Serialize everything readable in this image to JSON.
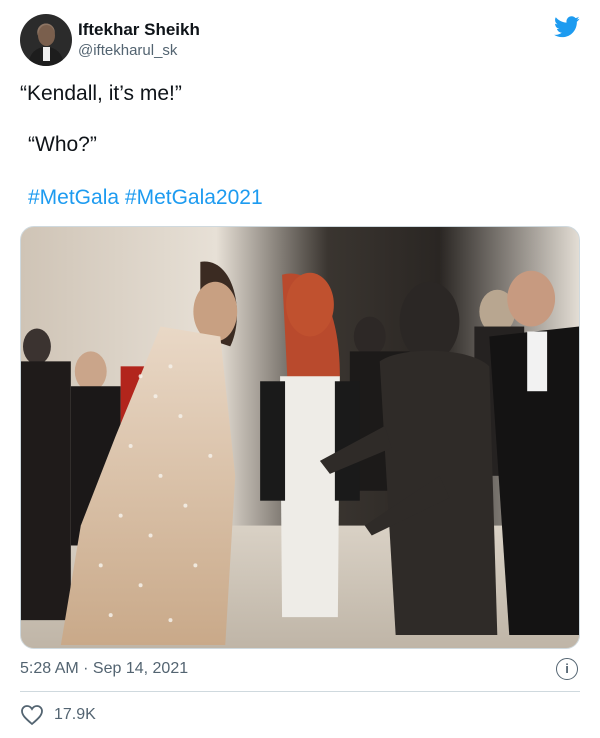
{
  "author": {
    "display_name": "Iftekhar Sheikh",
    "handle": "@iftekharul_sk"
  },
  "tweet": {
    "line1": "“Kendall, it’s me!”",
    "line2": "“Who?”",
    "hashtags": [
      "#MetGala",
      "#MetGala2021"
    ]
  },
  "meta": {
    "timestamp": "5:28 AM · Sep 14, 2021"
  },
  "engagement": {
    "likes": "17.9K"
  },
  "colors": {
    "accent": "#1d9bf0",
    "secondary_text": "#536471",
    "divider": "#cfd9de"
  },
  "icons": {
    "brand": "twitter-bird-icon",
    "info": "info-icon",
    "like": "heart-icon"
  }
}
